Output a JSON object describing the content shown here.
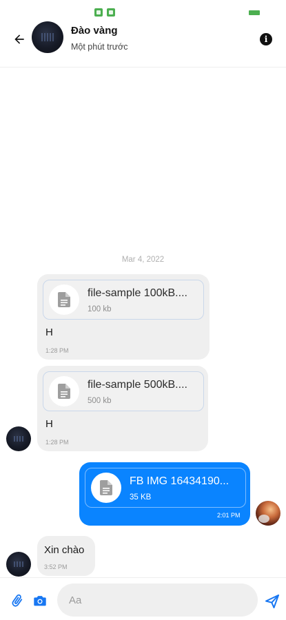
{
  "status_bar": {
    "colors": {
      "indicator": "#4caf50"
    }
  },
  "header": {
    "contact_name": "Đào vàng",
    "last_seen": "Một phút trước",
    "info_glyph": "i",
    "back_icon": "arrow-left-icon",
    "info_icon": "info-icon"
  },
  "conversation": {
    "date_separator": "Mar 4, 2022",
    "messages": [
      {
        "direction": "incoming",
        "file_name": "file-sample 100kB....",
        "file_size": "100 kb",
        "text": "H",
        "time": "1:28 PM"
      },
      {
        "direction": "incoming",
        "file_name": "file-sample 500kB....",
        "file_size": "500 kb",
        "text": "H",
        "time": "1:28 PM"
      },
      {
        "direction": "outgoing",
        "file_name": "FB IMG 16434190...",
        "file_size": "35 KB",
        "time": "2:01 PM"
      },
      {
        "direction": "incoming",
        "text": "Xin chào",
        "time": "3:52 PM"
      }
    ]
  },
  "composer": {
    "placeholder": "Aa",
    "attach_icon": "paperclip-icon",
    "camera_icon": "camera-icon",
    "send_icon": "send-icon"
  },
  "colors": {
    "accent": "#0a84ff",
    "incoming_bubble": "#efefef",
    "file_card_border": "#c9d7ea"
  }
}
